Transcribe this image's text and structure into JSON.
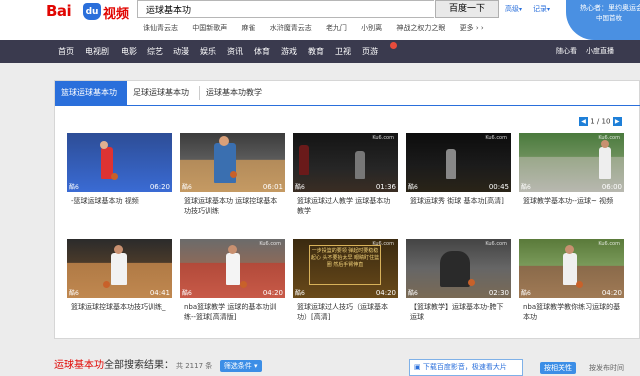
{
  "header": {
    "logo": {
      "text_bai": "Bai",
      "paw": "du",
      "text_video": "视频"
    },
    "search": {
      "value": "运球基本功",
      "button": "百度一下"
    },
    "advanced_label": "高级",
    "records_label": "记录",
    "hot_searches": [
      "诛仙青云志",
      "中国新歌声",
      "麻雀",
      "水浒魔青云志",
      "老九门",
      "小别离",
      "神战之权力之眼",
      "更多 › ›"
    ],
    "notice": {
      "line1": "热心者：里约奥运会",
      "line2": "中国首枚",
      "line3": "  "
    }
  },
  "nav": {
    "items": [
      "首页",
      "电视剧",
      "电影",
      "综艺",
      "动漫",
      "娱乐",
      "资讯",
      "体育",
      "游戏",
      "教育",
      "卫视",
      "页游"
    ],
    "right": [
      "随心看",
      "小度直播"
    ]
  },
  "panel": {
    "tabs": [
      "篮球运球基本功",
      "足球运球基本功",
      "运球基本功教学"
    ],
    "pager": "1 / 10",
    "row1": [
      {
        "caption": "-篮球运球基本功 视频",
        "duration": "06:20",
        "source": "酷6",
        "watermark": ""
      },
      {
        "caption": "篮球运球基本功 运球控球基本功技巧训练",
        "duration": "06:01",
        "source": "酷6",
        "watermark": ""
      },
      {
        "caption": "篮球运球过人教学 运球基本功教学",
        "duration": "01:36",
        "source": "酷6",
        "watermark": "Ku6.com"
      },
      {
        "caption": "篮球运球秀 街球 基本功[高清]",
        "duration": "00:45",
        "source": "酷6",
        "watermark": "Ku6.com"
      },
      {
        "caption": "篮球教学基本功--运球~ 视频",
        "duration": "06:00",
        "source": "酷6",
        "watermark": "Ku6.com"
      }
    ],
    "row2": [
      {
        "caption": "篮球运球控球基本功技巧训练_",
        "duration": "04:41",
        "source": "酷6",
        "watermark": ""
      },
      {
        "caption": "nba篮球教学 运球的基本功训练--篮球[高清版]",
        "duration": "04:20",
        "source": "酷6",
        "watermark": "Ku6.com"
      },
      {
        "caption": "篮球运球过人技巧（运球基本功）[高清]",
        "duration": "04:20",
        "source": "酷6",
        "watermark": "Ku6.com"
      },
      {
        "caption": "【篮球教学】运球基本功-胯下运球",
        "duration": "02:30",
        "source": "酷6",
        "watermark": "Ku6.com"
      },
      {
        "caption": "nba篮球教学教你练习运球的基本功",
        "duration": "04:20",
        "source": "酷6",
        "watermark": "Ku6.com"
      }
    ],
    "gold_text": "一步投篮的要领 弹起时要稳稳起心 头不要抬太早 眼睛盯住篮圈 然后手臂伸直"
  },
  "results": {
    "title_red": "运球基本功",
    "title_rest": "全部搜索结果：",
    "count": "共 2117 条",
    "filter_label": "筛选条件 ▾",
    "download_label": "下载百度影音，极速看大片",
    "time_button": "按相关性",
    "time_sort": "按发布时间"
  }
}
